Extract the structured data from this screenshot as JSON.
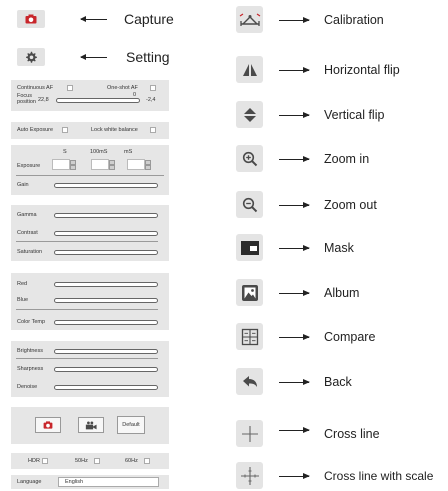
{
  "legend_left": {
    "capture_label": "Capture",
    "setting_label": "Setting"
  },
  "af_panel": {
    "continuous_af": "Continuous AF",
    "one_shot_af": "One-shot AF",
    "focus_position_line1": "Focus",
    "focus_position_line2": "position",
    "focus_value": "22,8",
    "focus_zero": "0",
    "focus_min": "-2,4"
  },
  "exposure_panel": {
    "auto_exposure": "Auto Exposure",
    "lock_white_balance": "Lock white balance"
  },
  "exposure_time": {
    "label": "Exposure",
    "unit_s": "S",
    "unit_100ms": "100mS",
    "unit_ms": "mS",
    "gain_label": "Gain"
  },
  "image_panel": {
    "gamma": "Gamma",
    "contrast": "Contrast",
    "saturation": "Saturation"
  },
  "color_panel": {
    "red": "Red",
    "blue": "Blue",
    "color_temp": "Color Temp"
  },
  "tone_panel": {
    "brightness": "Brightness",
    "sharpness": "Sharpness",
    "denoise": "Denoise"
  },
  "buttons_panel": {
    "default_label": "Default"
  },
  "misc_panel": {
    "hdr": "HDR",
    "hz50": "50Hz",
    "hz60": "60Hz",
    "language_label": "Language",
    "language_value": "English"
  },
  "legend_right": [
    {
      "icon": "calibration-icon",
      "label": "Calibration"
    },
    {
      "icon": "horizontal-flip-icon",
      "label": "Horizontal flip"
    },
    {
      "icon": "vertical-flip-icon",
      "label": "Vertical flip"
    },
    {
      "icon": "zoom-in-icon",
      "label": "Zoom in"
    },
    {
      "icon": "zoom-out-icon",
      "label": "Zoom out"
    },
    {
      "icon": "mask-icon",
      "label": "Mask"
    },
    {
      "icon": "album-icon",
      "label": "Album"
    },
    {
      "icon": "compare-icon",
      "label": "Compare"
    },
    {
      "icon": "back-icon",
      "label": "Back"
    },
    {
      "icon": "cross-line-icon",
      "label": "Cross line"
    },
    {
      "icon": "cross-line-scale-icon",
      "label": "Cross line with scale"
    }
  ],
  "colors": {
    "icon_red": "#c8262b",
    "icon_gray": "#4a4a4a",
    "panel_bg": "#e6e6e6"
  }
}
